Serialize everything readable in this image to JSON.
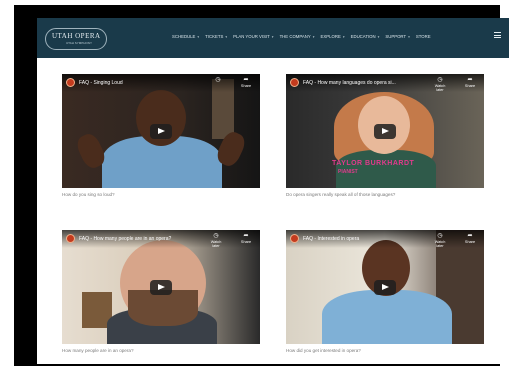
{
  "site": {
    "logo_text": "UTAH OPERA",
    "logo_sub": "UTAH SYMPHONY"
  },
  "nav": {
    "items": [
      {
        "label": "SCHEDULE"
      },
      {
        "label": "TICKETS"
      },
      {
        "label": "PLAN YOUR VISIT"
      },
      {
        "label": "THE COMPANY"
      },
      {
        "label": "EXPLORE"
      },
      {
        "label": "EDUCATION"
      },
      {
        "label": "SUPPORT"
      },
      {
        "label": "STORE"
      }
    ],
    "menu_icon": "hamburger-icon"
  },
  "videos": [
    {
      "title": "FAQ - Singing Loud",
      "caption": "How do you sing so loud?",
      "share": "Share",
      "watch_later": ""
    },
    {
      "title": "FAQ - How many languages do opera si...",
      "caption": "Do opera singers really speak all of those languages?",
      "share": "Share",
      "watch_later": "Watch later",
      "banner_name": "TAYLOR BURKHARDT",
      "banner_role": "PIANIST"
    },
    {
      "title": "FAQ - How many people are in an opera?",
      "caption": "How many people are in an opera?",
      "share": "Share",
      "watch_later": "Watch later"
    },
    {
      "title": "FAQ - Interested in opera",
      "caption": "How did you get interested in opera?",
      "share": "Share",
      "watch_later": "Watch later"
    }
  ],
  "colors": {
    "nav_bg": "#1a3a4a",
    "frame": "#000000",
    "channel_icon": "#c43b1e",
    "banner": "#e23a8c"
  }
}
